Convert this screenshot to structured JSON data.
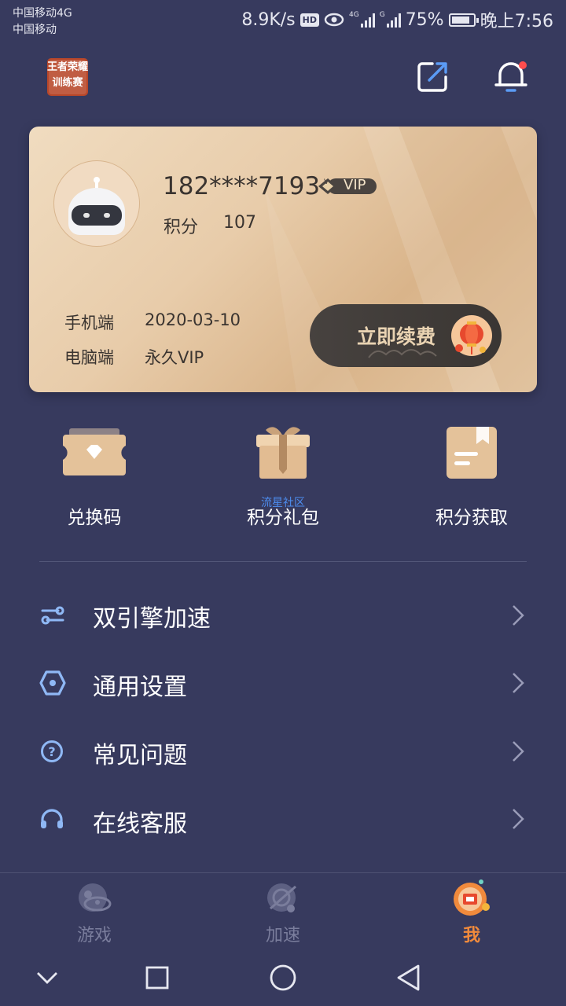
{
  "status_bar": {
    "carrier1": "中国移动4G",
    "carrier2": "中国移动",
    "speed": "8.9K/s",
    "hd": "HD",
    "signal1_label": "4G",
    "signal2_label": "G",
    "battery": "75%",
    "time": "晚上7:56"
  },
  "header": {
    "logo_text_line1": "王者荣耀",
    "logo_text_line2": "训练赛",
    "edit_icon": "edit-icon",
    "bell_icon": "bell-icon"
  },
  "card": {
    "phone": "182****7193",
    "vip_badge": "VIP",
    "vip_badge_v": "V",
    "points_label": "积分",
    "points_value": "107",
    "mobile_label": "手机端",
    "mobile_value": "2020-03-10",
    "pc_label": "电脑端",
    "pc_value": "永久VIP",
    "renew_button": "立即续费"
  },
  "shortcuts": [
    {
      "label": "兑换码",
      "icon": "ticket-icon"
    },
    {
      "label": "积分礼包",
      "icon": "gift-icon",
      "watermark": "流星社区"
    },
    {
      "label": "积分获取",
      "icon": "notebook-icon"
    }
  ],
  "menu": [
    {
      "label": "双引擎加速",
      "icon": "dual-engine-icon"
    },
    {
      "label": "通用设置",
      "icon": "hexagon-settings-icon"
    },
    {
      "label": "常见问题",
      "icon": "question-icon"
    },
    {
      "label": "在线客服",
      "icon": "headset-icon"
    }
  ],
  "tabs": [
    {
      "label": "游戏",
      "active": false
    },
    {
      "label": "加速",
      "active": false
    },
    {
      "label": "我",
      "active": true
    }
  ],
  "colors": {
    "background": "#373a5e",
    "menu_icon": "#8fb8f5",
    "active_tab": "#f08a3c",
    "inactive_tab": "#7a7d9c",
    "card_gold": "#e8ccaa"
  }
}
